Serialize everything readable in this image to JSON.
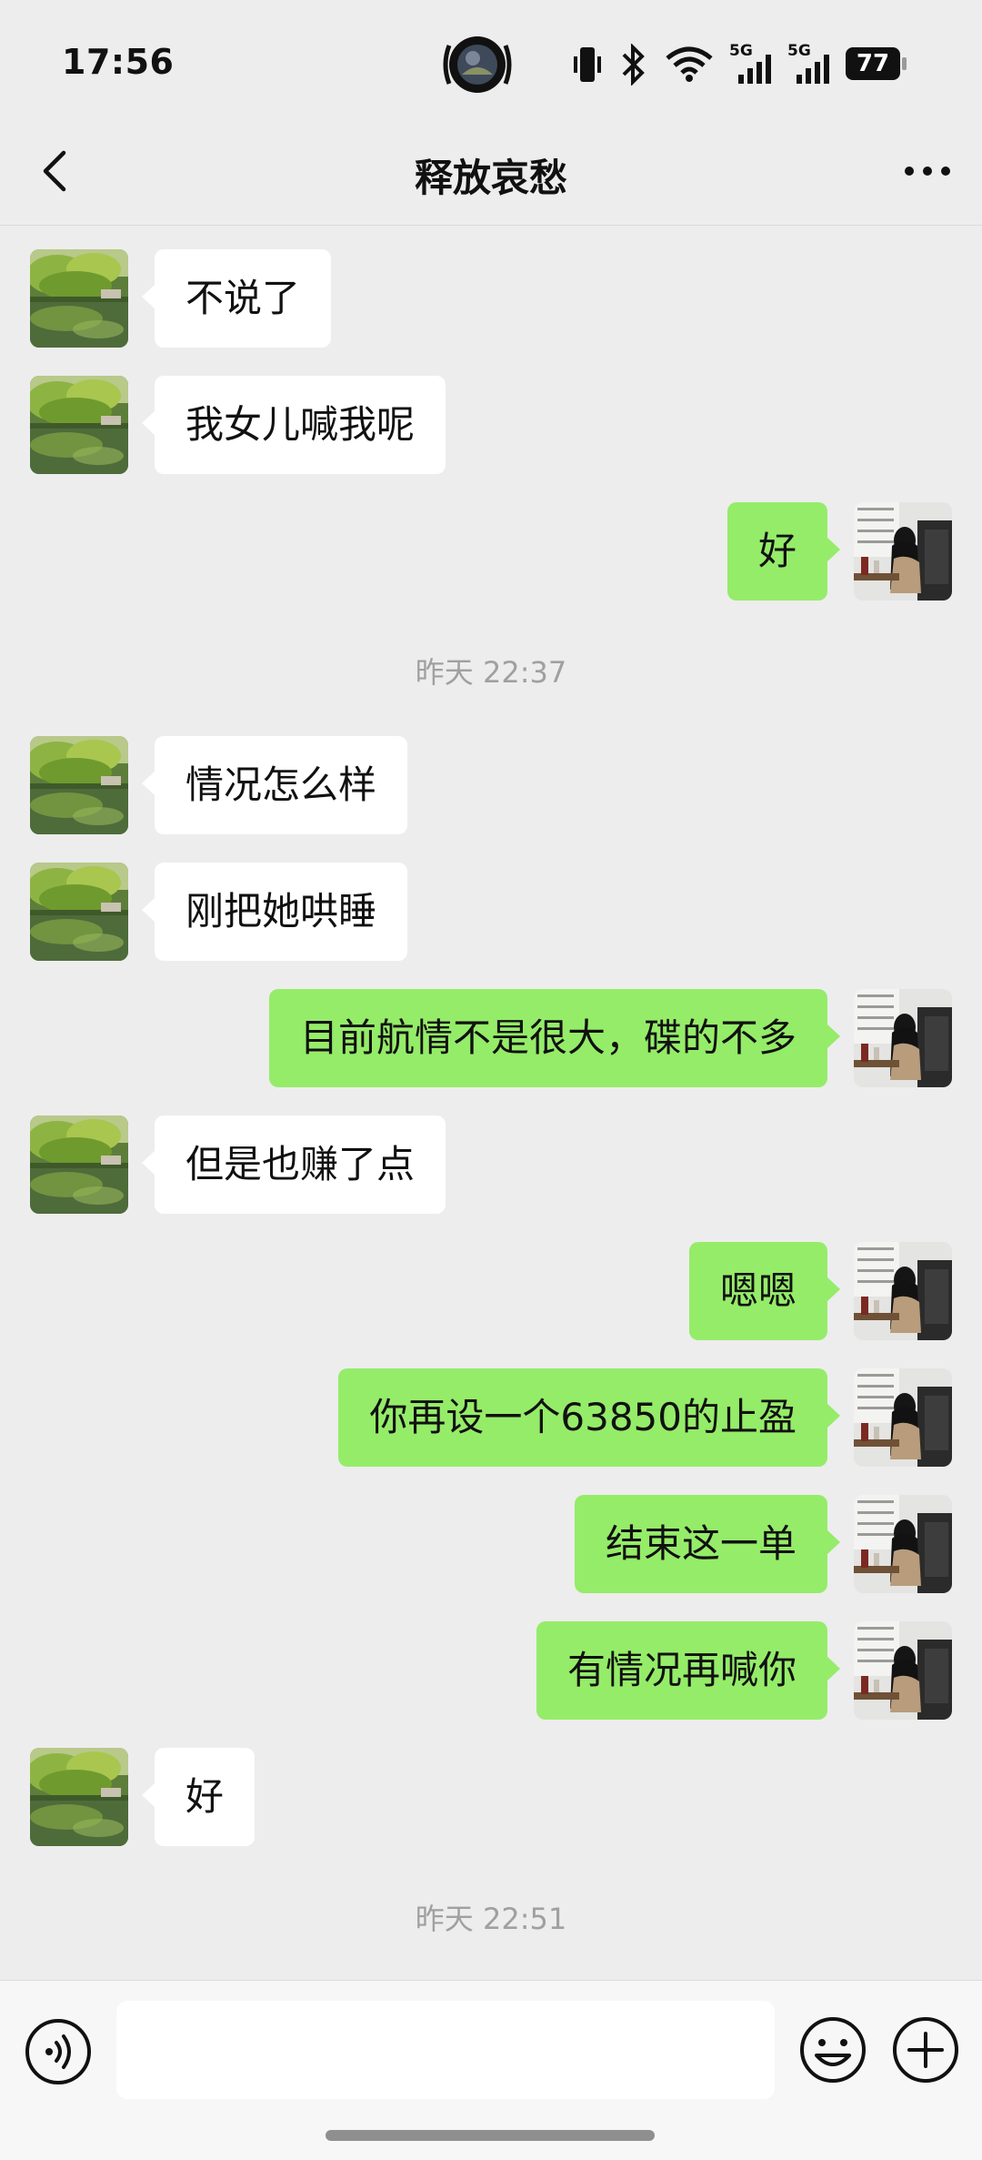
{
  "status_bar": {
    "time": "17:56",
    "battery_level": "77",
    "network_1": "5G",
    "network_2": "5G",
    "icons": [
      "camera-pill-icon",
      "vibrate-icon",
      "bluetooth-icon",
      "wifi-icon",
      "signal-5g-icon",
      "signal-5g-icon",
      "battery-icon"
    ]
  },
  "header": {
    "title": "释放哀愁",
    "back_icon": "chevron-left-icon",
    "more_icon": "more-horizontal-icon"
  },
  "messages": [
    {
      "side": "left",
      "text": "不说了"
    },
    {
      "side": "left",
      "text": "我女儿喊我呢"
    },
    {
      "side": "right",
      "text": "好"
    },
    {
      "type": "time",
      "text": "昨天 22:37"
    },
    {
      "side": "left",
      "text": "情况怎么样"
    },
    {
      "side": "left",
      "text": "刚把她哄睡"
    },
    {
      "side": "right",
      "text": "目前航情不是很大，碟的不多"
    },
    {
      "side": "left",
      "text": "但是也赚了点"
    },
    {
      "side": "right",
      "text": "嗯嗯"
    },
    {
      "side": "right",
      "text": "你再设一个63850的止盈"
    },
    {
      "side": "right",
      "text": "结束这一单"
    },
    {
      "side": "right",
      "text": "有情况再喊你"
    },
    {
      "side": "left",
      "text": "好"
    },
    {
      "type": "time",
      "text": "昨天 22:51"
    }
  ],
  "input_bar": {
    "input_value": "",
    "voice_icon": "voice-icon",
    "emoji_icon": "emoji-icon",
    "plus_icon": "plus-circle-icon"
  },
  "colors": {
    "background": "#EDEDED",
    "bubble_self": "#95EC69",
    "bubble_other": "#FFFFFF",
    "timestamp_text": "#A0A0A0"
  }
}
